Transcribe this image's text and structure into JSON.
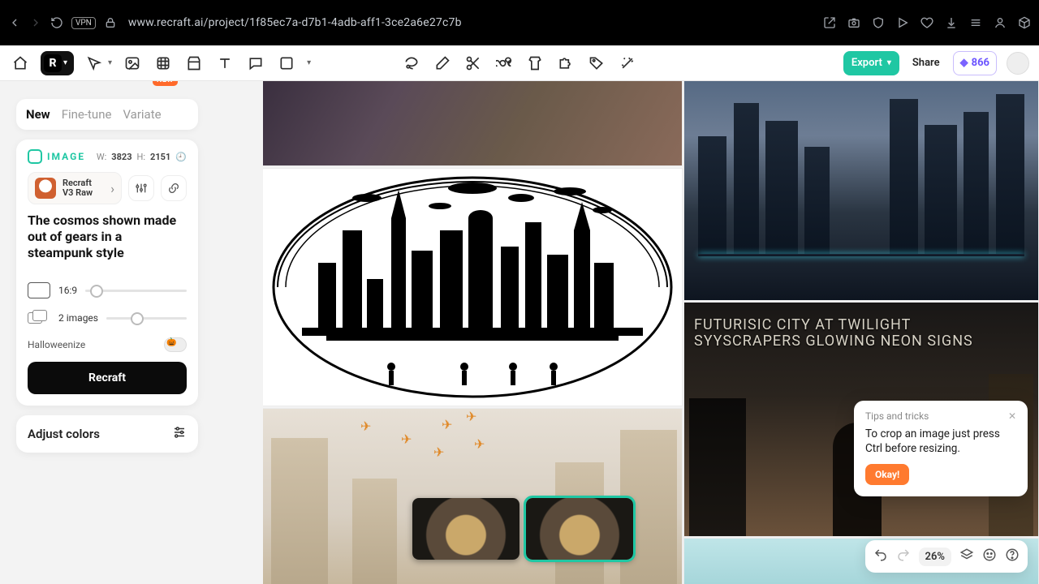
{
  "browser": {
    "url": "www.recraft.ai/project/1f85ec7a-d7b1-4adb-aff1-3ce2a6e27c7b",
    "vpn": "VPN"
  },
  "toolbar": {
    "export": "Export",
    "share": "Share",
    "credits": "866",
    "new_badge": "NEW"
  },
  "tabs": {
    "new": "New",
    "finetune": "Fine-tune",
    "variate": "Variate"
  },
  "image_card": {
    "label": "IMAGE",
    "w_label": "W:",
    "w": "3823",
    "h_label": "H:",
    "h": "2151",
    "model_line1": "Recraft",
    "model_line2": "V3 Raw",
    "prompt": "The cosmos shown made out of gears in a steampunk style",
    "aspect": "16:9",
    "count": "2 images",
    "hallo": "Halloweenize",
    "button": "Recraft"
  },
  "adjust": {
    "label": "Adjust colors"
  },
  "canvas": {
    "t5_line1": "FUTURISIC CITY AT TWILIGHT",
    "t5_line2": "SYYSCRAPERS GLOWING NEON SIGNS"
  },
  "tips": {
    "title": "Tips and tricks",
    "body": "To crop an image just press Ctrl before resizing.",
    "ok": "Okay!"
  },
  "bottom": {
    "zoom": "26%"
  }
}
